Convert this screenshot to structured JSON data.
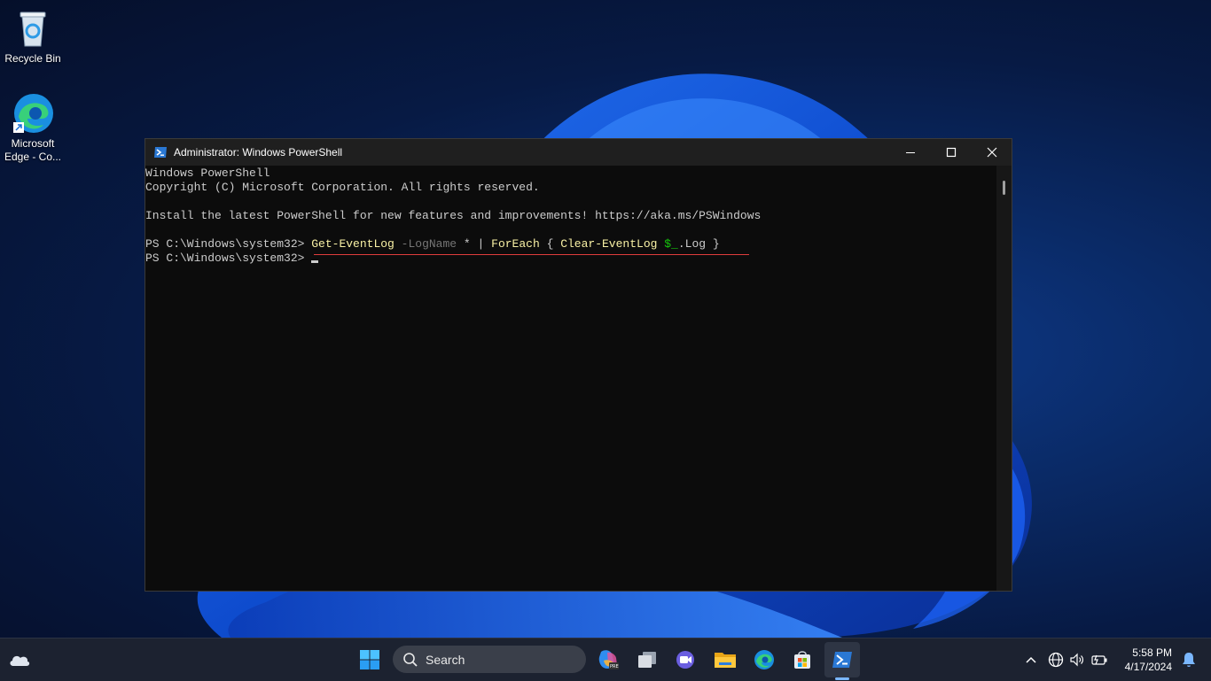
{
  "desktop": {
    "icons": [
      {
        "label": "Recycle Bin",
        "icon": "recycle-bin-icon"
      },
      {
        "label": "Microsoft Edge - Co...",
        "icon": "edge-shortcut-icon"
      }
    ]
  },
  "window": {
    "title": "Administrator: Windows PowerShell",
    "icon": "powershell-icon",
    "controls": [
      "minimize-icon",
      "maximize-icon",
      "close-icon"
    ]
  },
  "console": {
    "lines": [
      "Windows PowerShell",
      "Copyright (C) Microsoft Corporation. All rights reserved.",
      "",
      "Install the latest PowerShell for new features and improvements! https://aka.ms/PSWindows",
      ""
    ],
    "prompt": "PS C:\\Windows\\system32> ",
    "command": {
      "cmd1": "Get-EventLog",
      "param": "-LogName",
      "arg": "*",
      "pipe": "|",
      "cmd2": "ForEach",
      "open_brace": "{",
      "cmd3": "Clear-EventLog",
      "var": "$_",
      "member": ".Log",
      "close_brace": "}"
    },
    "prompt2": "PS C:\\Windows\\system32> "
  },
  "taskbar": {
    "search_label": "Search",
    "apps": [
      "start-icon",
      "search-icon",
      "copilot-icon",
      "task-view-icon",
      "meet-icon",
      "file-explorer-icon",
      "edge-icon",
      "store-icon",
      "powershell-icon"
    ],
    "tray_icons": [
      "chevron-up-icon",
      "network-icon",
      "volume-icon",
      "battery-icon",
      "notification-bell-icon"
    ],
    "time": "5:58 PM",
    "date": "4/17/2024",
    "weather_icon": "weather-cloud-icon"
  },
  "colors": {
    "console_bg": "#0c0c0c",
    "console_text": "#cccccc",
    "command_yellow": "#f9f1a5",
    "param_gray": "#767676",
    "variable_green": "#16c60c",
    "underline_red": "#e03c3c"
  }
}
